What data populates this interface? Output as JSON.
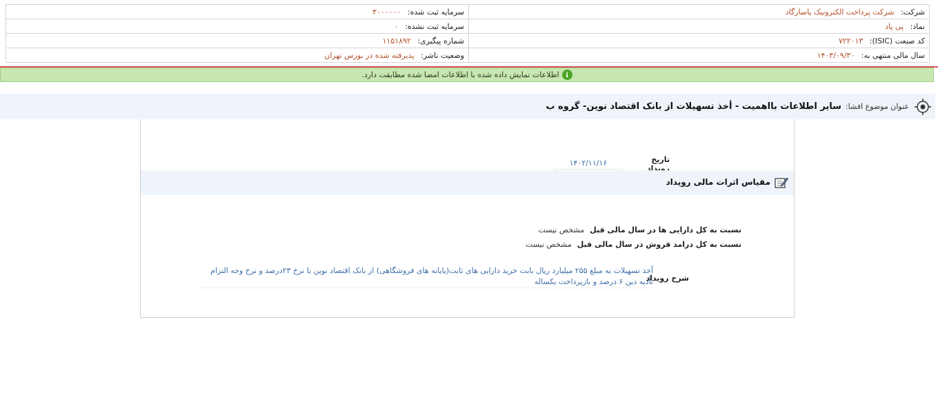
{
  "header": {
    "company_label": "شرکت:",
    "company_value": "شرکت پرداخت الکترونیک پاسارگاد",
    "registered_capital_label": "سرمایه ثبت شده:",
    "registered_capital_value": "۳۰۰۰۰۰۰",
    "symbol_label": "نماد:",
    "symbol_value": "پی پاد",
    "unregistered_capital_label": "سرمایه ثبت نشده:",
    "unregistered_capital_value": "۰",
    "isic_label": "کد صنعت (ISIC):",
    "isic_value": "۷۲۲۰۱۳",
    "tracking_label": "شماره پیگیری:",
    "tracking_value": "۱۱۵۱۸۹۲",
    "fiscal_year_label": "سال مالی منتهی به:",
    "fiscal_year_value": "۱۴۰۳/۰۹/۳۰",
    "publisher_status_label": "وضعیت ناشر:",
    "publisher_status_value": "پذیرفته شده در بورس تهران"
  },
  "notice": {
    "icon": "info-icon",
    "text": "اطلاعات نمایش داده شده با اطلاعات امضا شده مطابقت دارد."
  },
  "title": {
    "icon": "target-icon",
    "label": "عنوان موضوع افشا:",
    "value": "سایر اطلاعات بااهمیت - أخذ تسهیلات از بانک اقتصاد نوین- گروه ب"
  },
  "event": {
    "date_label": "تاریخ رویداد",
    "date_value": "۱۴۰۲/۱۱/۱۶"
  },
  "section": {
    "icon": "edit-note-icon",
    "title": "مقیاس اثرات مالی رویداد"
  },
  "ratios": [
    {
      "label": "نسبت به کل دارایی ها در سال مالی قبل",
      "value": "مشخص نیست"
    },
    {
      "label": "نسبت به کل درامد فروش در سال مالی قبل",
      "value": "مشخص نیست"
    }
  ],
  "description": {
    "label": "شرح رویداد",
    "value": "أخذ تسهیلات به مبلغ ۲۵۵ میلیارد ریال بابت خرید دارایی های ثابت(پایانه های فروشگاهی) از بانک اقتصاد نوین با نرخ ۲۳درصد و نرخ وجه التزام تأدیه دین ۶ درصد و بازپرداخت یکساله"
  },
  "colors": {
    "value_orange": "#b5502a",
    "link_blue": "#3e6ea8",
    "notice_green": "#c8e6b0",
    "header_bg": "#eef4fa"
  }
}
